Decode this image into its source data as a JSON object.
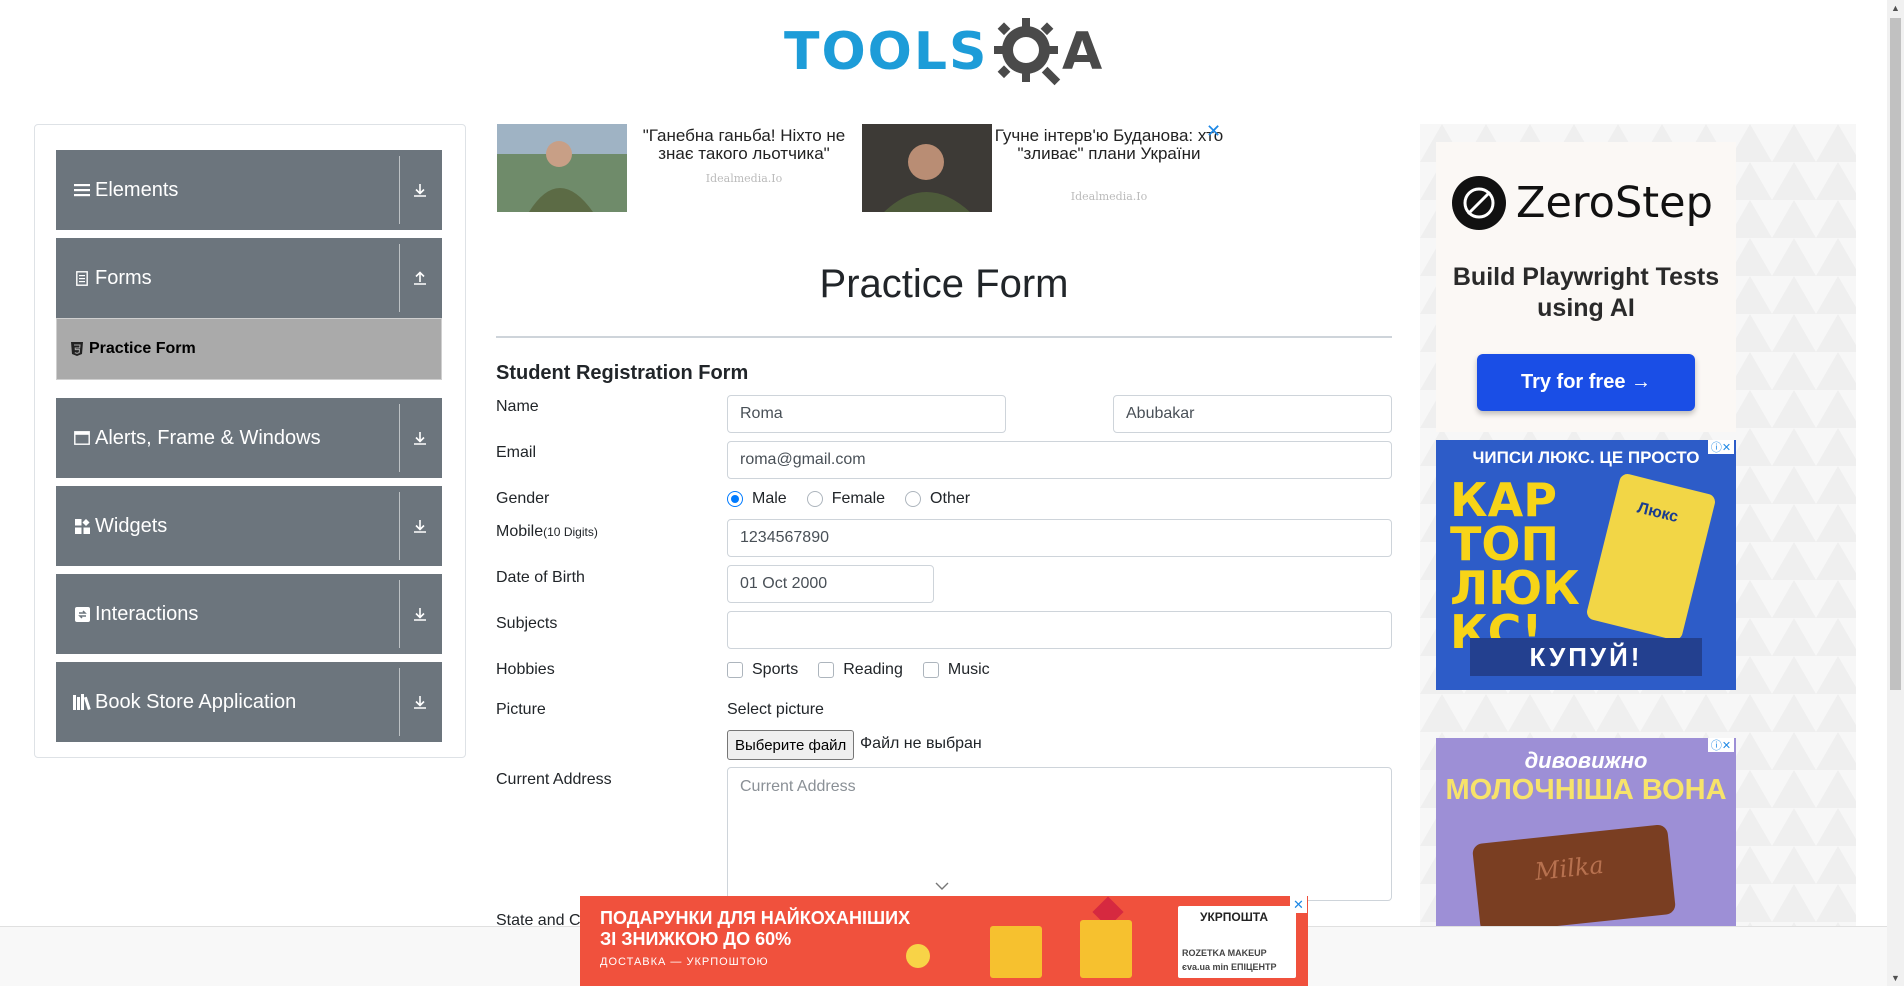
{
  "brand": {
    "logo_text": "TOOLS",
    "logo_letter": "A"
  },
  "sidebar": {
    "groups": [
      {
        "label": "Elements",
        "icon": "hamburger-icon",
        "arrow": "download-arrow-icon"
      },
      {
        "label": "Forms",
        "icon": "document-icon",
        "arrow": "upload-arrow-icon"
      },
      {
        "label": "Alerts, Frame & Windows",
        "icon": "window-icon",
        "arrow": "download-arrow-icon"
      },
      {
        "label": "Widgets",
        "icon": "widgets-grid-icon",
        "arrow": "download-arrow-icon"
      },
      {
        "label": "Interactions",
        "icon": "interaction-icon",
        "arrow": "download-arrow-icon"
      },
      {
        "label": "Book Store Application",
        "icon": "books-icon",
        "arrow": "download-arrow-icon"
      }
    ],
    "active_item": {
      "label": "Practice Form",
      "icon": "html5-icon"
    }
  },
  "top_ads": [
    {
      "text": "\"Ганебна ганьба! Ніхто не знає такого льотчика\"",
      "source": "Idealmedia.Io"
    },
    {
      "text": "Гучне інтерв'ю Буданова: хто \"зливає\" плани України",
      "source": "Idealmedia.Io"
    }
  ],
  "form": {
    "title": "Practice Form",
    "subtitle": "Student Registration Form",
    "labels": {
      "name": "Name",
      "email": "Email",
      "gender": "Gender",
      "mobile": "Mobile",
      "mobile_hint": "(10 Digits)",
      "dob": "Date of Birth",
      "subjects": "Subjects",
      "hobbies": "Hobbies",
      "picture": "Picture",
      "address": "Current Address",
      "state_city": "State and Ci"
    },
    "first_name": "Roma",
    "last_name": "Abubakar",
    "email": "roma@gmail.com",
    "gender_options": [
      "Male",
      "Female",
      "Other"
    ],
    "gender_selected": "Male",
    "mobile": "1234567890",
    "dob": "01 Oct 2000",
    "subjects": "",
    "hobbies": [
      "Sports",
      "Reading",
      "Music"
    ],
    "picture_caption": "Select picture",
    "file_button": "Выберите файл",
    "file_status": "Файл не выбран",
    "address_placeholder": "Current Address"
  },
  "right_ads": {
    "zerostep": {
      "name": "ZeroStep",
      "tagline": "Build Playwright Tests using AI",
      "button": "Try for free →"
    },
    "chips": {
      "top": "ЧИПСИ ЛЮКС. ЦЕ ПРОСТО",
      "big": "КАР ТОП ЛЮК КС!",
      "brand": "Люкс",
      "buy": "КУПУЙ!"
    },
    "milka": {
      "line1": "дивовижно",
      "line2": "МОЛОЧНІША ВОНА",
      "brand": "Milka"
    }
  },
  "bottom_ad": {
    "headline": "ПОДАРУНКИ ДЛЯ НАЙКОХАНІШИХ ЗІ ЗНИЖКОЮ ДО 60%",
    "sub": "ДОСТАВКА — УКРПОШТОЮ",
    "brand": "УКРПОШТА",
    "partners": "ROZETKA MAKEUP єva.ua min ЕПІЦЕНТР"
  },
  "colors": {
    "sidebar_group": "#6c757d",
    "active_item": "#aaaaaa",
    "accent_blue": "#007bff",
    "logo_blue": "#1d9cd8",
    "zerostep_button": "#1a4ee6",
    "bottom_ad": "#f0513d"
  }
}
